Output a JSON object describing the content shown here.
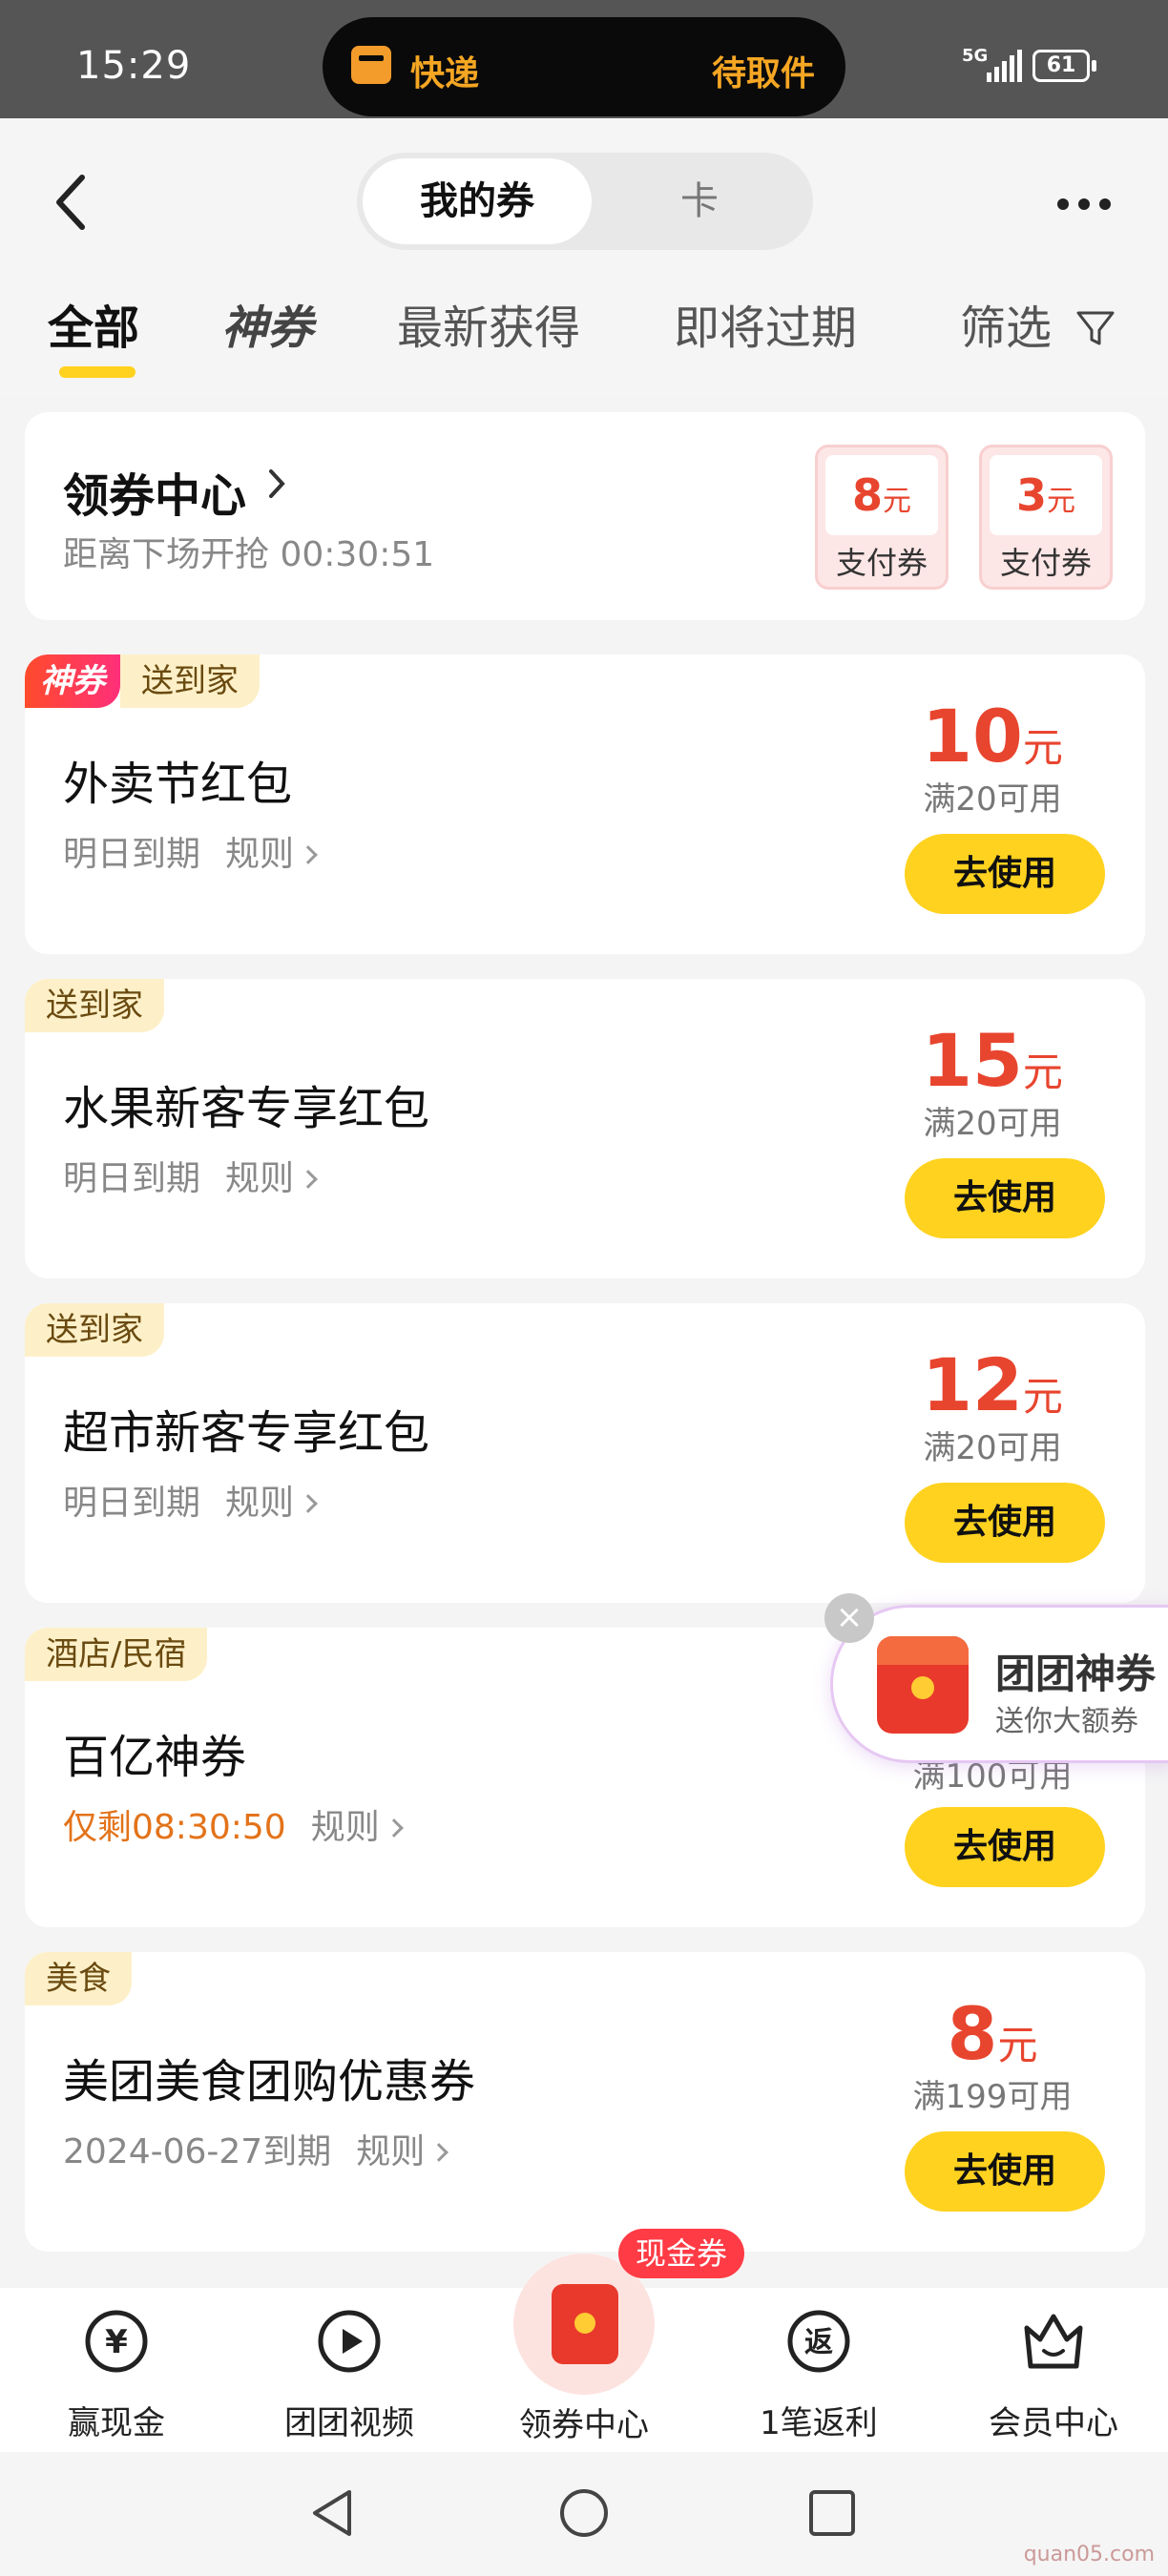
{
  "status_bar": {
    "time": "15:29",
    "network": "5G",
    "battery": "61",
    "island_left": "快递",
    "island_right": "待取件"
  },
  "header": {
    "seg_active": "我的券",
    "seg_inactive": "卡"
  },
  "tabs": {
    "all": "全部",
    "god": "神券",
    "newest": "最新获得",
    "expiring": "即将过期",
    "filter": "筛选"
  },
  "center": {
    "title": "领券中心",
    "subtitle": "距离下场开抢 00:30:51",
    "pay_coupons": [
      {
        "amount": "8",
        "unit": "元",
        "label": "支付券"
      },
      {
        "amount": "3",
        "unit": "元",
        "label": "支付券"
      }
    ]
  },
  "coupons": [
    {
      "god_tag": "神券",
      "tag": "送到家",
      "title": "外卖节红包",
      "expiry": "明日到期",
      "rule": "规则",
      "amount": "10",
      "unit": "元",
      "condition": "满20可用",
      "button": "去使用"
    },
    {
      "tag": "送到家",
      "title": "水果新客专享红包",
      "expiry": "明日到期",
      "rule": "规则",
      "amount": "15",
      "unit": "元",
      "condition": "满20可用",
      "button": "去使用"
    },
    {
      "tag": "送到家",
      "title": "超市新客专享红包",
      "expiry": "明日到期",
      "rule": "规则",
      "amount": "12",
      "unit": "元",
      "condition": "满20可用",
      "button": "去使用"
    },
    {
      "tag": "酒店/民宿",
      "title": "百亿神券",
      "expiry": "仅剩08:30:50",
      "rule": "规则",
      "condition": "满100可用",
      "button": "去使用"
    },
    {
      "tag": "美食",
      "title": "美团美食团购优惠券",
      "expiry": "2024-06-27到期",
      "rule": "规则",
      "amount": "8",
      "unit": "元",
      "condition": "满199可用",
      "button": "去使用"
    }
  ],
  "floating": {
    "title": "团团神券",
    "subtitle": "送你大额券",
    "close": "×"
  },
  "bottom_nav": {
    "items": [
      {
        "label": "赢现金",
        "icon": "yen-coin-icon"
      },
      {
        "label": "团团视频",
        "icon": "play-icon"
      },
      {
        "label": "领券中心",
        "icon": "red-envelope-icon"
      },
      {
        "label": "1笔返利",
        "icon": "rebate-icon"
      },
      {
        "label": "会员中心",
        "icon": "crown-icon"
      }
    ],
    "badge": "现金券"
  },
  "watermark": "quan05.com",
  "colors": {
    "accent_yellow": "#ffd21f",
    "price_red": "#e8452f",
    "warn_orange": "#e3731a"
  }
}
